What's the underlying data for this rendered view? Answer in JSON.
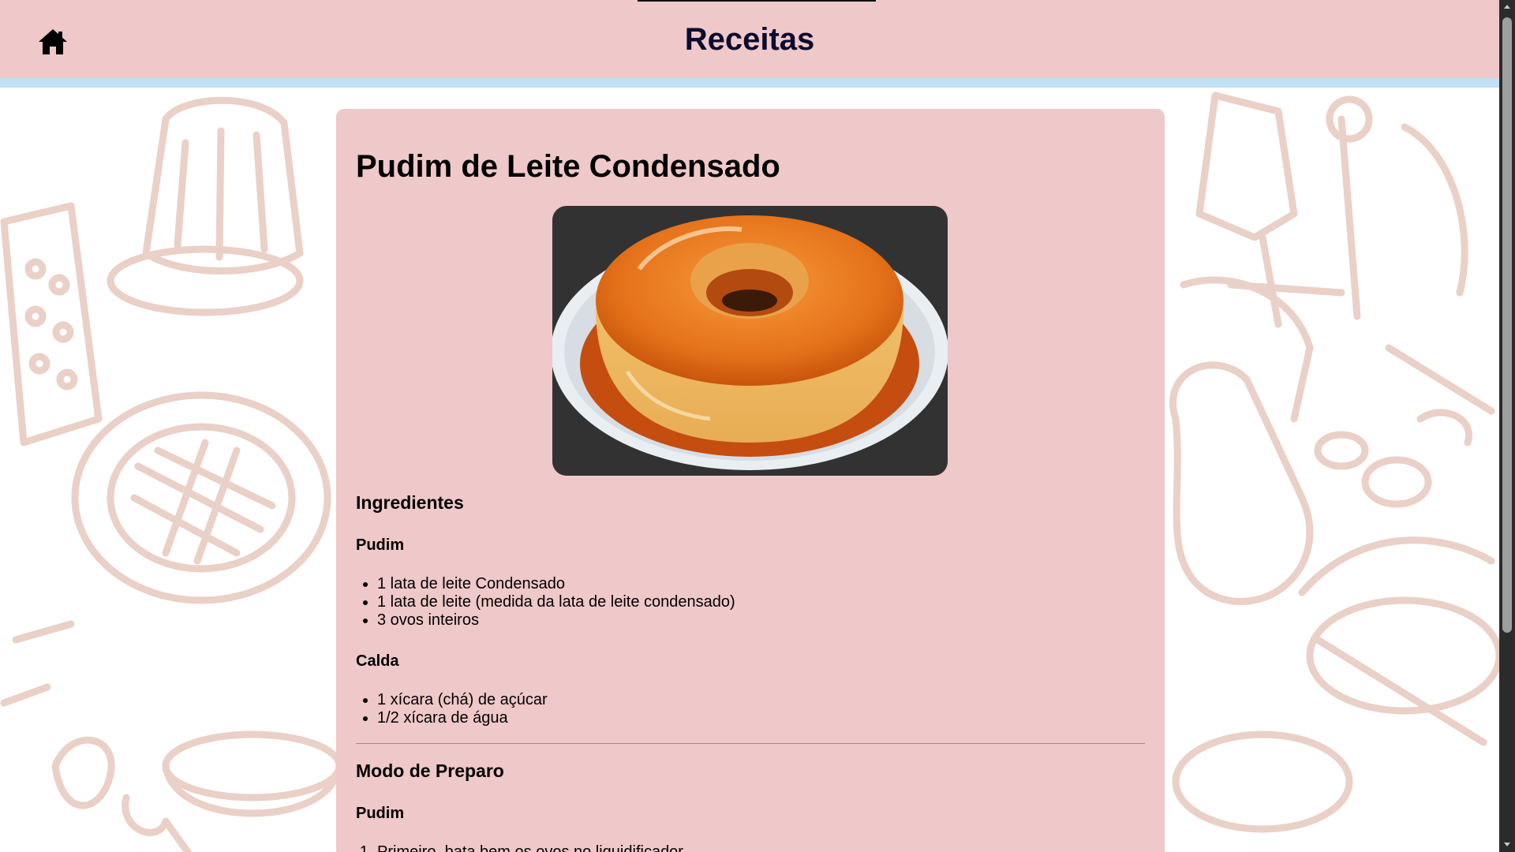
{
  "colors": {
    "header_bg": "#efc8c9",
    "header_border": "#bfe0f5",
    "card_bg": "#efc8c9",
    "sketch_stroke": "#e9cbc2",
    "title_color": "#0b0b2e"
  },
  "header": {
    "home_icon": "home-icon",
    "title": "Receitas"
  },
  "recipe": {
    "title": "Pudim de Leite Condensado",
    "image_subject": "pudim-photo",
    "ingredients": {
      "heading": "Ingredientes",
      "groups": [
        {
          "name": "Pudim",
          "items": [
            "1 lata de leite Condensado",
            "1 lata de leite (medida da lata de leite condensado)",
            "3 ovos inteiros"
          ]
        },
        {
          "name": "Calda",
          "items": [
            "1 xícara (chá) de açúcar",
            "1/2 xícara de água"
          ]
        }
      ]
    },
    "preparation": {
      "heading": "Modo de Preparo",
      "groups": [
        {
          "name": "Pudim",
          "steps": [
            "Primeiro, bata bem os ovos no liquidificador."
          ]
        }
      ]
    }
  }
}
